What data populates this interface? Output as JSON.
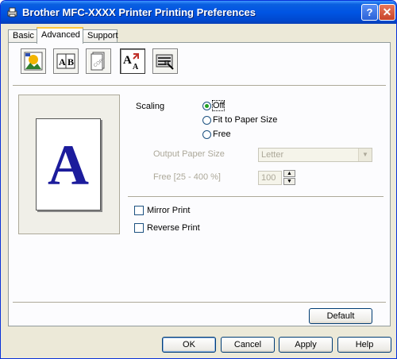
{
  "window": {
    "title": "Brother MFC-XXXX Printer Printing Preferences",
    "help_label": "?",
    "close_label": "✕"
  },
  "tabs": [
    {
      "label": "Basic",
      "active": false
    },
    {
      "label": "Advanced",
      "active": true
    },
    {
      "label": "Support",
      "active": false
    }
  ],
  "toolbar": {
    "items": [
      {
        "icon": "color-settings-icon"
      },
      {
        "icon": "ab-layout-icon"
      },
      {
        "icon": "copy-watermark-icon"
      },
      {
        "icon": "scaling-icon",
        "pressed": true
      },
      {
        "icon": "device-options-icon"
      }
    ]
  },
  "preview": {
    "glyph": "A"
  },
  "scaling": {
    "label": "Scaling",
    "options": [
      {
        "label": "Off",
        "checked": true
      },
      {
        "label": "Fit to Paper Size",
        "checked": false
      },
      {
        "label": "Free",
        "checked": false
      }
    ]
  },
  "output_paper_size": {
    "label": "Output Paper Size",
    "value": "Letter",
    "arrow": "▼"
  },
  "free_scale": {
    "label": "Free [25 - 400 %]",
    "value": "100",
    "up": "▲",
    "down": "▼"
  },
  "mirror_print": {
    "label": "Mirror Print",
    "checked": false
  },
  "reverse_print": {
    "label": "Reverse Print",
    "checked": false
  },
  "buttons": {
    "default": "Default",
    "ok": "OK",
    "cancel": "Cancel",
    "apply": "Apply",
    "help": "Help"
  },
  "colors": {
    "title_bar": "#0054e3",
    "glyph": "#1c1c9c",
    "radio_dot": "#21a121"
  }
}
